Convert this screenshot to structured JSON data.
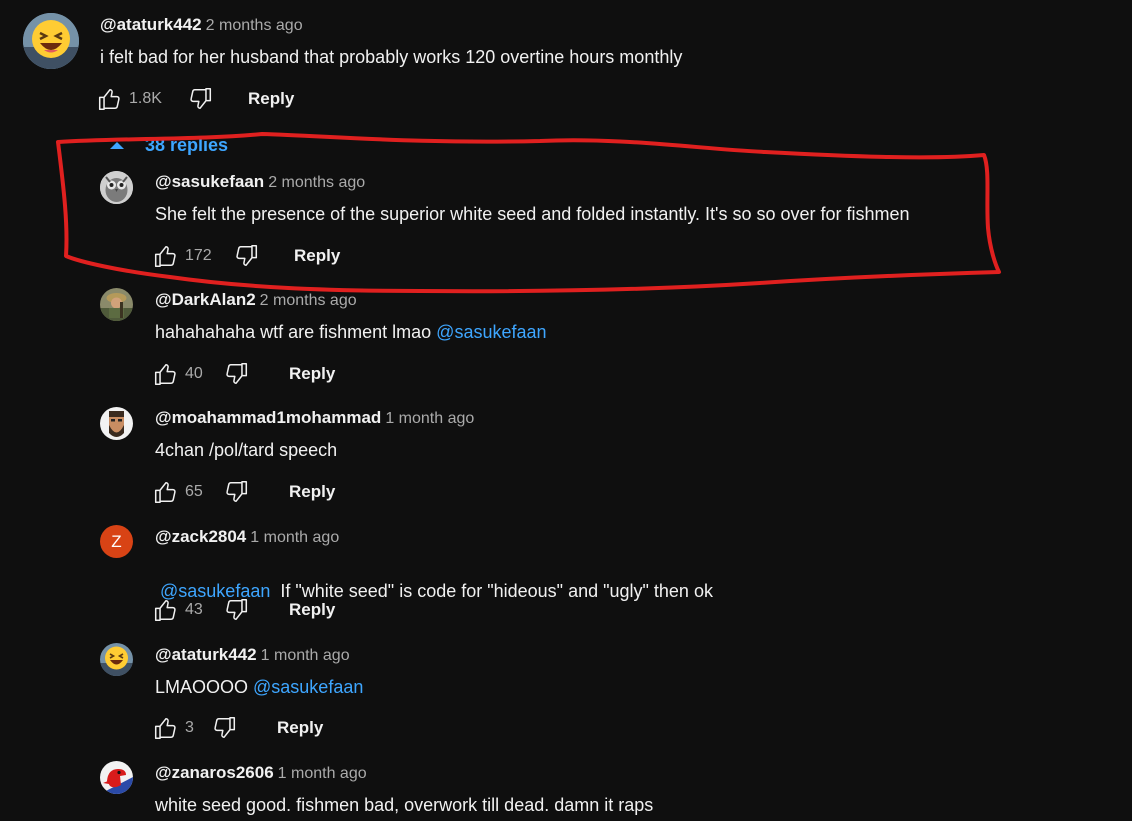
{
  "top_comment": {
    "author": "@ataturk442",
    "time": "2 months ago",
    "text": "i felt bad for her husband that probably works 120 overtine hours monthly",
    "likes": "1.8K",
    "reply_label": "Reply",
    "avatar_icon": "laughing-emoji-icon"
  },
  "replies_toggle": {
    "label": "38 replies",
    "icon": "caret-up-icon",
    "color": "#3ea6ff"
  },
  "replies": [
    {
      "author": "@sasukefaan",
      "time": "2 months ago",
      "text": "She felt the presence of the superior white seed and folded instantly. It's so so over for fishmen",
      "likes": "172",
      "reply_label": "Reply",
      "avatar_icon": "owl-avatar"
    },
    {
      "author": "@DarkAlan2",
      "time": "2 months ago",
      "text": "hahahahaha wtf are fishment lmao ",
      "mention": "@sasukefaan",
      "likes": "40",
      "reply_label": "Reply",
      "avatar_icon": "soldier-avatar"
    },
    {
      "author": "@moahammad1mohammad",
      "time": "1 month ago",
      "text": "4chan /pol/tard speech",
      "likes": "65",
      "reply_label": "Reply",
      "avatar_icon": "bearded-man-avatar"
    },
    {
      "author": "@zack2804",
      "time": "1 month ago",
      "mention": "@sasukefaan",
      "text": "  If \"white seed\" is code for \"hideous\" and \"ugly\" then ok",
      "likes": "43",
      "reply_label": "Reply",
      "avatar_letter": "Z"
    },
    {
      "author": "@ataturk442",
      "time": "1 month ago",
      "text": "LMAOOOO ",
      "mention": "@sasukefaan",
      "likes": "3",
      "reply_label": "Reply",
      "avatar_icon": "laughing-emoji-icon"
    },
    {
      "author": "@zanaros2606",
      "time": "1 month ago",
      "text": "white seed good. fishmen bad, overwork till dead. damn it raps",
      "avatar_icon": "red-dinosaur-avatar"
    }
  ],
  "colors": {
    "background": "#0f0f0f",
    "text": "#f1f1f1",
    "secondary_text": "#aaaaaa",
    "link": "#3ea6ff",
    "annotation": "#e0201f"
  }
}
